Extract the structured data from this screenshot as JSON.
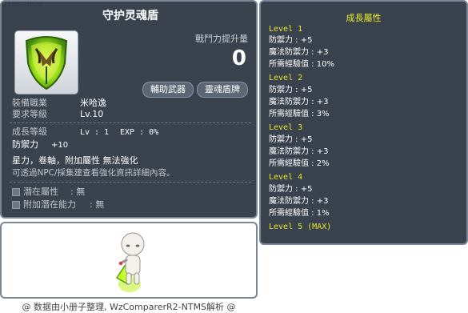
{
  "item_id": "01098000",
  "item": {
    "name": "守护灵魂盾",
    "icon": "glowing-green-soul-shield-icon",
    "power_label": "戰鬥力提升量",
    "power_value": "0",
    "tags": [
      "輔助武器",
      "靈魂盾牌"
    ]
  },
  "info": {
    "job_label": "裝備職業",
    "job_value": "米哈逸",
    "req_label": "要求等級",
    "req_value": "Lv.10"
  },
  "growth_summary": {
    "label": "成長等級",
    "level_text": "Lv : 1",
    "exp_text": "EXP : 0%"
  },
  "stat": {
    "label": "防禦力",
    "value": "+10"
  },
  "flags": "星力，卷軸，附加屬性 無法強化",
  "notice": "可透過NPC/採集建查看強化資訊詳細內容。",
  "potentials": [
    {
      "label": "潛在屬性",
      "value": ": 無"
    },
    {
      "label": "附加潛在能力",
      "value": ": 無"
    }
  ],
  "growth_panel": {
    "title": "成長屬性",
    "levels": [
      {
        "title": "Level 1",
        "lines": [
          "防禦力 : +5",
          "魔法防禦力 : +3",
          "所需經驗值 : 10%"
        ]
      },
      {
        "title": "Level 2",
        "lines": [
          "防禦力 : +5",
          "魔法防禦力 : +3",
          "所需經驗值 : 3%"
        ]
      },
      {
        "title": "Level 3",
        "lines": [
          "防禦力 : +5",
          "魔法防禦力 : +3",
          "所需經驗值 : 2%"
        ]
      },
      {
        "title": "Level 4",
        "lines": [
          "防禦力 : +5",
          "魔法防禦力 : +3",
          "所需經驗值 : 1%"
        ]
      },
      {
        "title": "Level 5 (MAX)",
        "lines": []
      }
    ]
  },
  "footer": "@ 数据由小册子整理, WzComparerR2-NTMS解析 @",
  "colors": {
    "panel": "#343c48",
    "accent_yellow": "#e4e62b",
    "border": "#7a8698"
  }
}
